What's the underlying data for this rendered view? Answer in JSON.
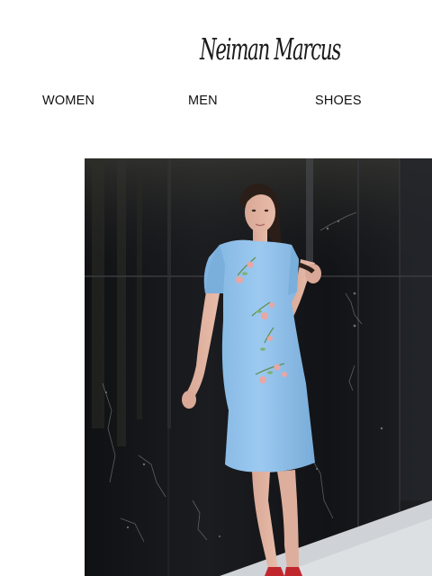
{
  "brand": {
    "logo_text": "Neiman Marcus"
  },
  "nav": {
    "items": [
      {
        "label": "WOMEN"
      },
      {
        "label": "MEN"
      },
      {
        "label": "SHOES"
      }
    ]
  },
  "hero": {
    "icon": "photo-model-blue-floral-dress"
  },
  "colors": {
    "text": "#111111",
    "dress": "#8fc0ea",
    "wall": "#141518"
  }
}
